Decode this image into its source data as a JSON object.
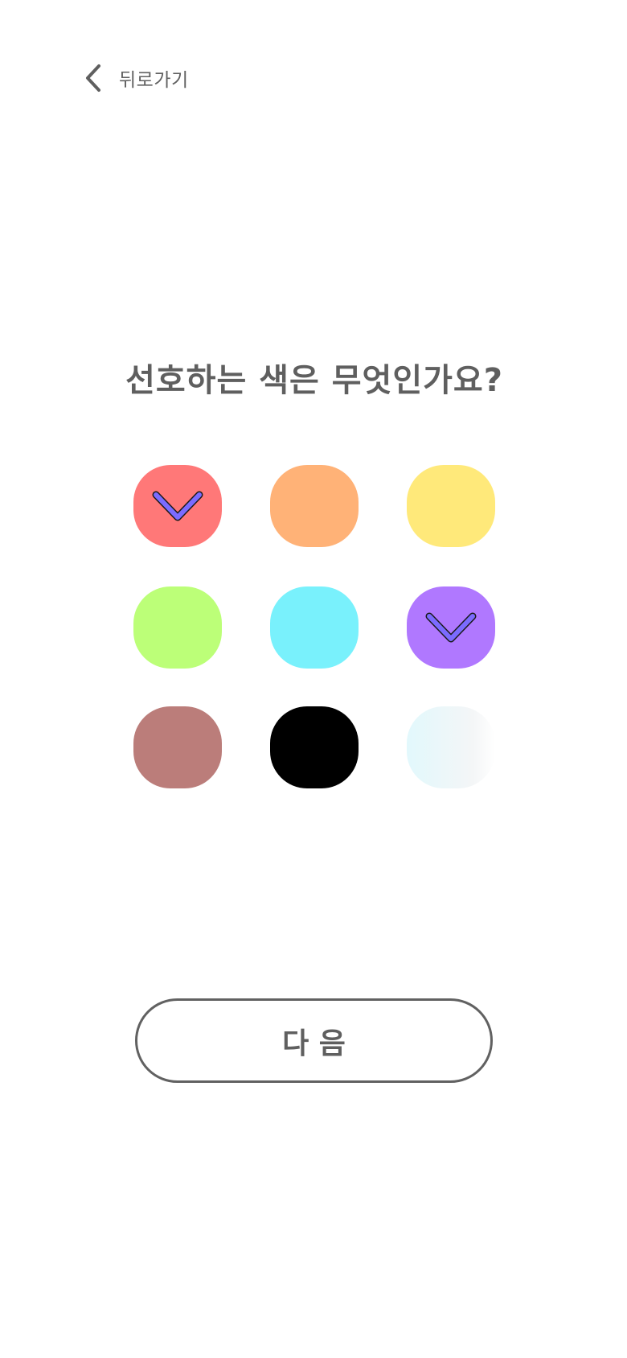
{
  "header": {
    "back_label": "뒤로가기",
    "back_icon": "chevron-left-icon"
  },
  "question": {
    "title": "선호하는 색은 무엇인가요?"
  },
  "colors": [
    {
      "id": "red",
      "fill": "#ff7878",
      "selected": true
    },
    {
      "id": "orange",
      "fill": "#ffb277",
      "selected": false
    },
    {
      "id": "yellow",
      "fill": "#ffe97a",
      "selected": false
    },
    {
      "id": "lime",
      "fill": "#bcff78",
      "selected": false
    },
    {
      "id": "cyan",
      "fill": "#79f1fc",
      "selected": false
    },
    {
      "id": "purple",
      "fill": "#b078ff",
      "selected": true
    },
    {
      "id": "brown",
      "fill": "#bb7d7a",
      "selected": false
    },
    {
      "id": "black",
      "fill": "#000000",
      "selected": false
    },
    {
      "id": "white-gradient",
      "fill": "linear-gradient(90deg, #e2f8fc 0%, #f4f6f7 75%, #ffffff 100%)",
      "selected": false
    }
  ],
  "selection_icon": "check-chevron-icon",
  "selection_color": "#7b6bff",
  "footer": {
    "next_label": "다 음"
  }
}
